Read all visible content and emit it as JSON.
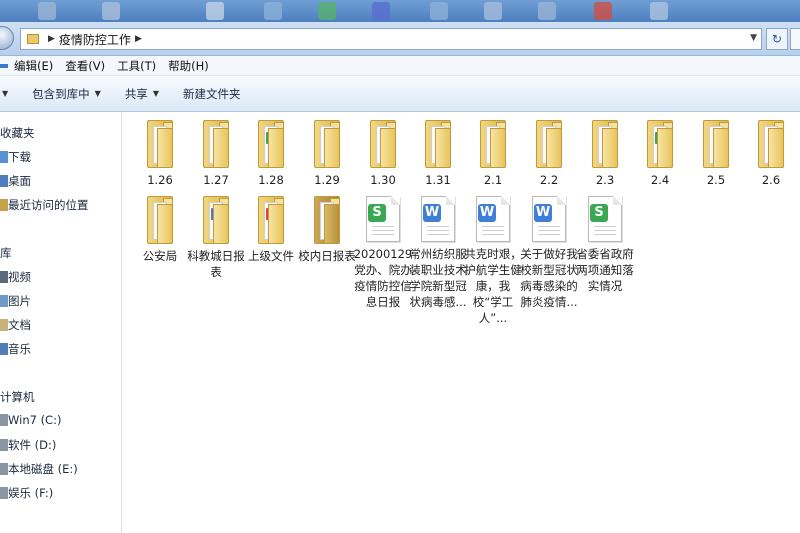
{
  "window": {
    "breadcrumb": "疫情防控工作",
    "colors": {
      "accent": "#3a78c8",
      "folder": "#e3b848",
      "word": "#3f7fd8",
      "sheet": "#3aa853",
      "pdf": "#e0403a"
    }
  },
  "menu": [
    "编辑(E)",
    "查看(V)",
    "工具(T)",
    "帮助(H)"
  ],
  "menu_first": "",
  "toolbar": {
    "organize_label": "",
    "include_label": "包含到库中",
    "share_label": "共享",
    "new_folder_label": "新建文件夹"
  },
  "sidebar": {
    "favorites_label": "收藏夹",
    "favorites": [
      "下载",
      "桌面",
      "最近访问的位置"
    ],
    "libraries_label": "库",
    "libraries": [
      "视频",
      "图片",
      "文档",
      "音乐"
    ],
    "computer_label": "计算机",
    "drives": [
      "Win7 (C:)",
      "软件 (D:)",
      "本地磁盘 (E:)",
      "娱乐 (F:)"
    ]
  },
  "items_row1": [
    {
      "label": "1.26",
      "kind": "folder"
    },
    {
      "label": "1.27",
      "kind": "folder"
    },
    {
      "label": "1.28",
      "kind": "folder-sheet"
    },
    {
      "label": "1.29",
      "kind": "folder"
    },
    {
      "label": "1.30",
      "kind": "folder"
    },
    {
      "label": "1.31",
      "kind": "folder"
    },
    {
      "label": "2.1",
      "kind": "folder"
    },
    {
      "label": "2.2",
      "kind": "folder"
    },
    {
      "label": "2.3",
      "kind": "folder"
    },
    {
      "label": "2.4",
      "kind": "folder-sheet"
    },
    {
      "label": "2.5",
      "kind": "folder"
    },
    {
      "label": "2.6",
      "kind": "folder"
    }
  ],
  "items_row2": [
    {
      "label": "公安局",
      "kind": "folder"
    },
    {
      "label": "科教城日报表",
      "kind": "folder-doc"
    },
    {
      "label": "上级文件",
      "kind": "folder-pdf"
    },
    {
      "label": "校内日报表",
      "kind": "folder-dark"
    },
    {
      "label": "20200129党办、院办疫情防控信息日报",
      "kind": "sheet"
    },
    {
      "label": "常州纺织服装职业技术学院新型冠状病毒感...",
      "kind": "word"
    },
    {
      "label": "共克时艰，护航学生健康，我校“学工人”...",
      "kind": "word"
    },
    {
      "label": "关于做好我校新型冠状病毒感染的肺炎疫情...",
      "kind": "word"
    },
    {
      "label": "省委省政府两项通知落实情况",
      "kind": "sheet"
    }
  ]
}
